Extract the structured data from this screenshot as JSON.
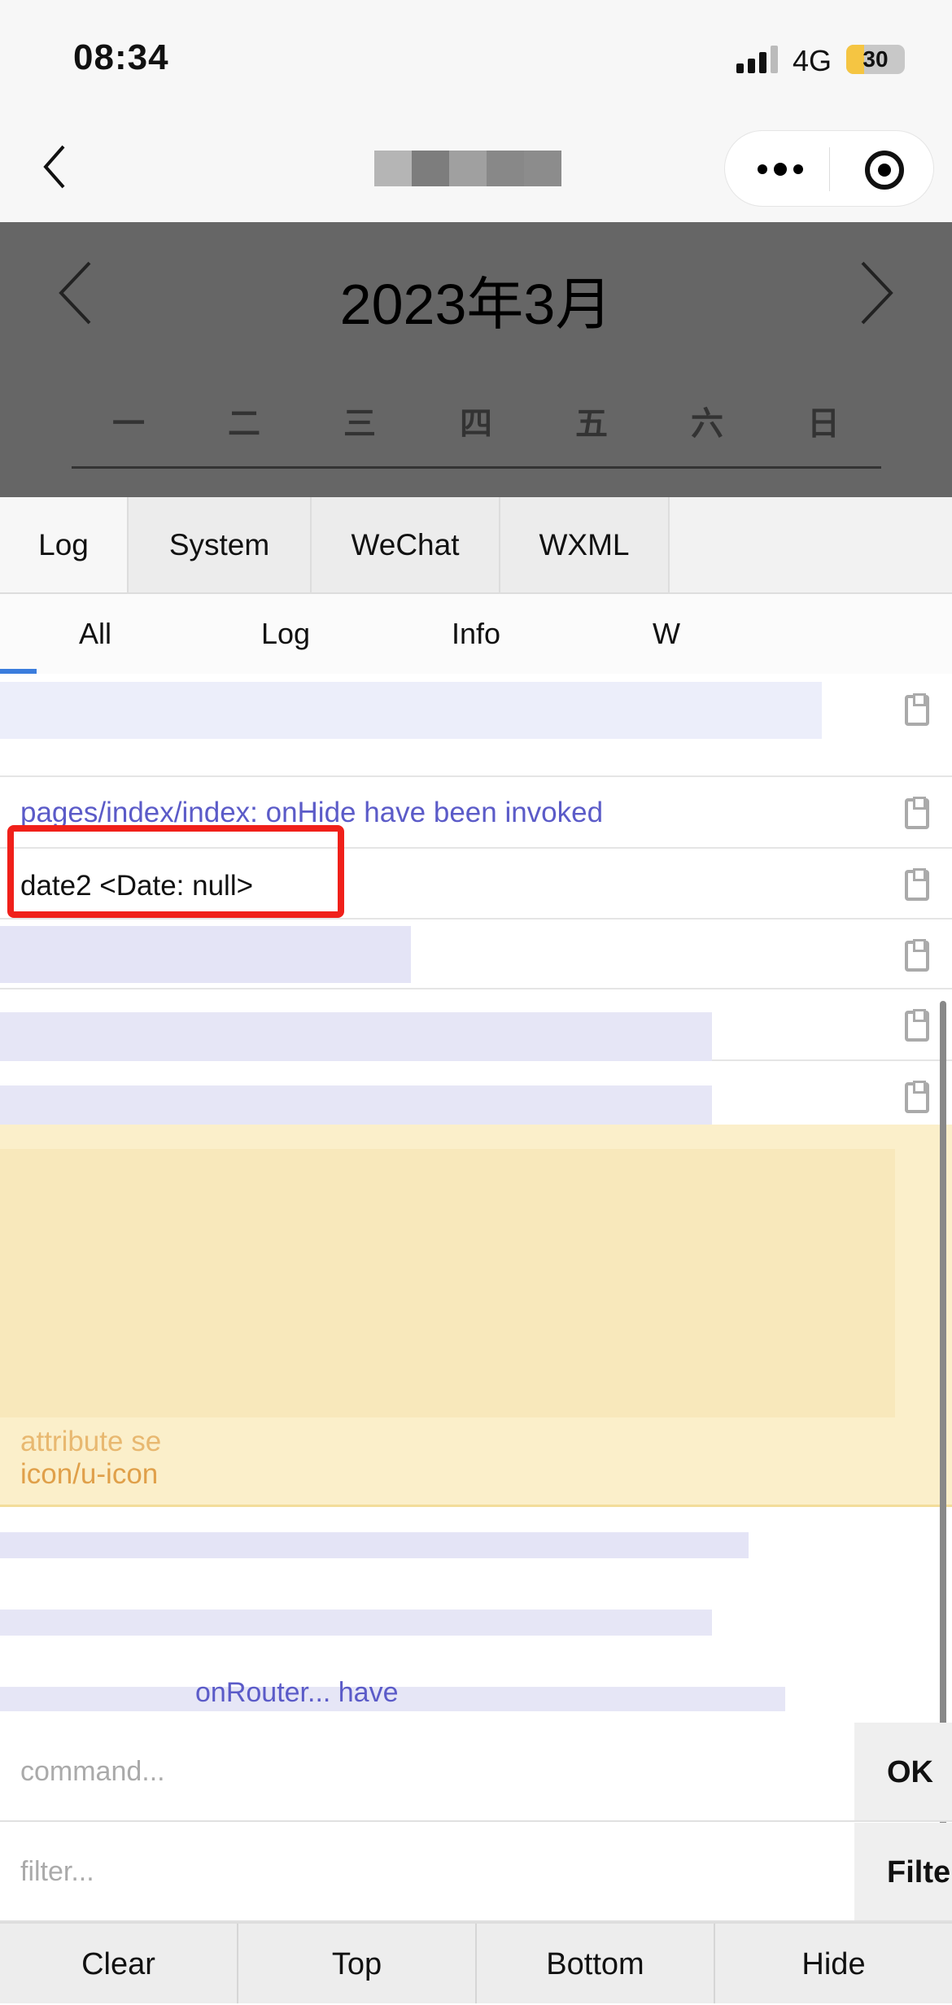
{
  "status_bar": {
    "time": "08:34",
    "network": "4G",
    "battery": "30",
    "battery_level_percent": 30,
    "battery_color": "#f5c542"
  },
  "calendar": {
    "title": "2023年3月",
    "weekdays": [
      "一",
      "二",
      "三",
      "四",
      "五",
      "六",
      "日"
    ]
  },
  "console": {
    "tabs": [
      {
        "label": "Log"
      },
      {
        "label": "System"
      },
      {
        "label": "WeChat"
      },
      {
        "label": "WXML"
      }
    ],
    "subtabs": [
      {
        "label": "All"
      },
      {
        "label": "Log"
      },
      {
        "label": "Info"
      },
      {
        "label": "W"
      }
    ],
    "logs": [
      {
        "text": "pages/index/index: onHide have been invoked",
        "color": "#5b5bc8"
      },
      {
        "text": "date2 <Date: null>",
        "color": "#111111"
      }
    ],
    "warn_fragments": [
      "attribute se",
      "icon/u-icon"
    ],
    "log_fragment": "onRouter... have",
    "command_placeholder": "command...",
    "ok_label": "OK",
    "filter_placeholder": "filter...",
    "filter_label": "Filter",
    "toolbar": [
      {
        "label": "Clear"
      },
      {
        "label": "Top"
      },
      {
        "label": "Bottom"
      },
      {
        "label": "Hide"
      }
    ]
  },
  "highlight_color": "#f0201a"
}
